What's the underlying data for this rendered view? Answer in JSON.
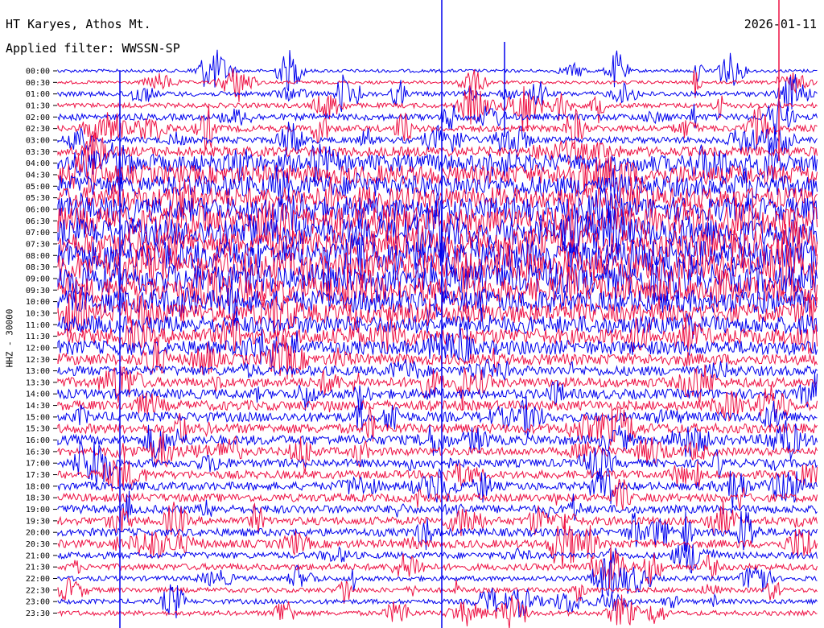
{
  "header": {
    "station": "HT Karyes, Athos Mt.",
    "filter": "Applied filter: WWSSN-SP",
    "date": "2026-01-11"
  },
  "chart_data": {
    "type": "line",
    "title": "HT Karyes, Athos Mt.",
    "ylabel": "HHZ - 30000",
    "row_labels": [
      "00:00",
      "00:30",
      "01:00",
      "01:30",
      "02:00",
      "02:30",
      "03:00",
      "03:30",
      "04:00",
      "04:30",
      "05:00",
      "05:30",
      "06:00",
      "06:30",
      "07:00",
      "07:30",
      "08:00",
      "08:30",
      "09:00",
      "09:30",
      "10:00",
      "10:30",
      "11:00",
      "11:30",
      "12:00",
      "12:30",
      "13:00",
      "13:30",
      "14:00",
      "14:30",
      "15:00",
      "15:30",
      "16:00",
      "16:30",
      "17:00",
      "17:30",
      "18:00",
      "18:30",
      "19:00",
      "19:30",
      "20:00",
      "20:30",
      "21:00",
      "21:30",
      "22:00",
      "22:30",
      "23:00",
      "23:30"
    ],
    "trace_colors": [
      "#0000ee",
      "#ee1144"
    ],
    "noise_amplitude": [
      2,
      2,
      3,
      3,
      4,
      4,
      4,
      6,
      11,
      12,
      13,
      13,
      15,
      17,
      17,
      17,
      18,
      18,
      18,
      16,
      14,
      12,
      11,
      10,
      9,
      7,
      6,
      6,
      6,
      6,
      6,
      6,
      6,
      5,
      5,
      5,
      5,
      5,
      5,
      5,
      5,
      5,
      4,
      4,
      3,
      3,
      3,
      3
    ]
  }
}
